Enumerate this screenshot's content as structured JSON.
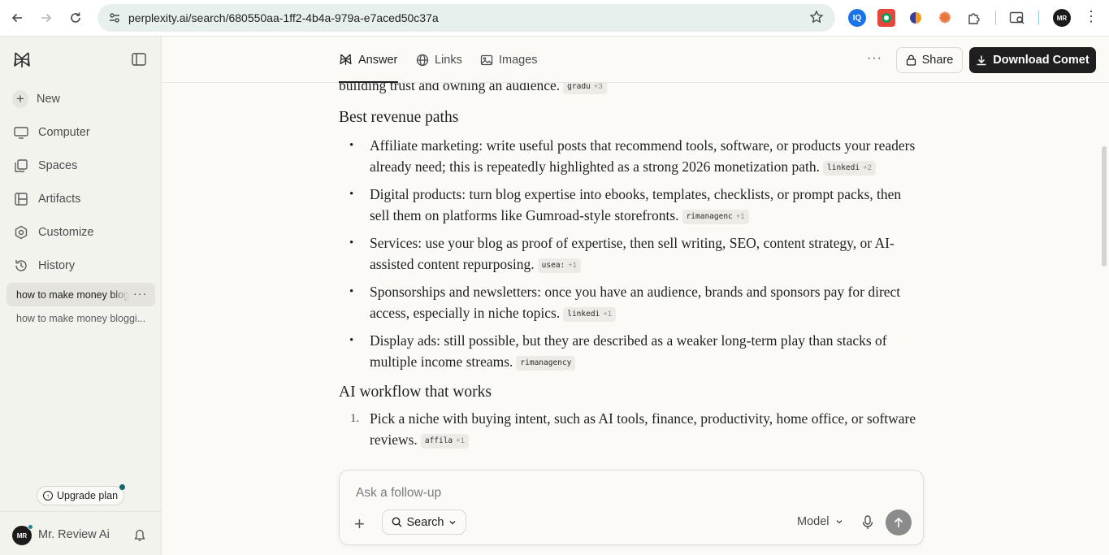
{
  "browser": {
    "url": "perplexity.ai/search/680550aa-1ff2-4b4a-979a-e7aced50c37a",
    "profile_initials": "MR"
  },
  "sidebar": {
    "items": [
      {
        "label": "New",
        "icon": "plus-icon"
      },
      {
        "label": "Computer",
        "icon": "computer-icon"
      },
      {
        "label": "Spaces",
        "icon": "spaces-icon"
      },
      {
        "label": "Artifacts",
        "icon": "artifacts-icon"
      },
      {
        "label": "Customize",
        "icon": "customize-icon"
      },
      {
        "label": "History",
        "icon": "history-icon"
      }
    ],
    "threads": [
      "how to make money blogging",
      "how to make money bloggi..."
    ],
    "upgrade_label": "Upgrade plan",
    "user_name": "Mr. Review Ai",
    "user_initials": "MR"
  },
  "header": {
    "tabs": [
      "Answer",
      "Links",
      "Images"
    ],
    "share_label": "Share",
    "download_label": "Download Comet"
  },
  "content": {
    "intro_tail": "building trust and owning an audience.",
    "intro_cite": {
      "src": "gradu",
      "more": "+3"
    },
    "section1_title": "Best revenue paths",
    "bullets": [
      {
        "text": "Affiliate marketing: write useful posts that recommend tools, software, or products your readers already need; this is repeatedly highlighted as a strong 2026 monetization path.",
        "cite": "linkedi",
        "more": "+2"
      },
      {
        "text": "Digital products: turn blog expertise into ebooks, templates, checklists, or prompt packs, then sell them on platforms like Gumroad-style storefronts.",
        "cite": "rimanagenc",
        "more": "+1"
      },
      {
        "text": "Services: use your blog as proof of expertise, then sell writing, SEO, content strategy, or AI-assisted content repurposing.",
        "cite": "usea:",
        "more": "+1"
      },
      {
        "text": "Sponsorships and newsletters: once you have an audience, brands and sponsors pay for direct access, especially in niche topics.",
        "cite": "linkedi",
        "more": "+1"
      },
      {
        "text": "Display ads: still possible, but they are described as a weaker long-term play than stacks of multiple income streams.",
        "cite": "rimanagency",
        "more": ""
      }
    ],
    "section2_title": "AI workflow that works",
    "steps": [
      {
        "num": "1.",
        "text": "Pick a niche with buying intent, such as AI tools, finance, productivity, home office, or software reviews.",
        "cite": "affila",
        "more": "+1"
      }
    ]
  },
  "ask": {
    "placeholder": "Ask a follow-up",
    "search_label": "Search",
    "model_label": "Model"
  },
  "colors": {
    "accent_teal": "#21808d",
    "dark_button": "#1f1f1f",
    "sidebar_bg": "#f3f3ee",
    "page_bg": "#fbfaf7"
  }
}
